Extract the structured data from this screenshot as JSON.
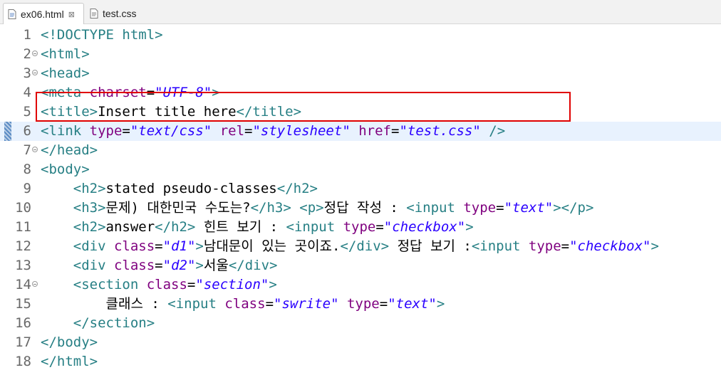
{
  "tabs": [
    {
      "label": "ex06.html",
      "active": true,
      "close": "⊠"
    },
    {
      "label": "test.css",
      "active": false
    }
  ],
  "highlight_color": "#e00000",
  "lines": [
    {
      "num": "1",
      "fold": false,
      "tokens": [
        [
          "tag",
          "<!DOCTYPE html>"
        ]
      ]
    },
    {
      "num": "2",
      "fold": true,
      "tokens": [
        [
          "tag",
          "<html>"
        ]
      ]
    },
    {
      "num": "3",
      "fold": true,
      "tokens": [
        [
          "tag",
          "<head>"
        ]
      ]
    },
    {
      "num": "4",
      "fold": false,
      "tokens": [
        [
          "tag",
          "<meta "
        ],
        [
          "attr",
          "charset"
        ],
        [
          "txt",
          "="
        ],
        [
          "val",
          "\"UTF-8\""
        ],
        [
          "tag",
          ">"
        ]
      ]
    },
    {
      "num": "5",
      "fold": false,
      "tokens": [
        [
          "tag",
          "<title>"
        ],
        [
          "txt",
          "Insert title here"
        ],
        [
          "tag",
          "</title>"
        ]
      ]
    },
    {
      "num": "6",
      "fold": false,
      "current": true,
      "tokens": [
        [
          "tag",
          "<link "
        ],
        [
          "attr",
          "type"
        ],
        [
          "txt",
          "="
        ],
        [
          "val",
          "\"text/css\""
        ],
        [
          "txt",
          " "
        ],
        [
          "attr",
          "rel"
        ],
        [
          "txt",
          "="
        ],
        [
          "val",
          "\"stylesheet\""
        ],
        [
          "txt",
          " "
        ],
        [
          "attr",
          "href"
        ],
        [
          "txt",
          "="
        ],
        [
          "val",
          "\"test.css\""
        ],
        [
          "txt",
          " "
        ],
        [
          "tag",
          "/>"
        ]
      ]
    },
    {
      "num": "7",
      "fold": true,
      "tokens": [
        [
          "tag",
          "</head>"
        ]
      ]
    },
    {
      "num": "8",
      "fold": false,
      "tokens": [
        [
          "tag",
          "<body>"
        ]
      ]
    },
    {
      "num": "9",
      "fold": false,
      "tokens": [
        [
          "txt",
          "    "
        ],
        [
          "tag",
          "<h2>"
        ],
        [
          "txt",
          "stated pseudo-classes"
        ],
        [
          "tag",
          "</h2>"
        ]
      ]
    },
    {
      "num": "10",
      "fold": false,
      "tokens": [
        [
          "txt",
          "    "
        ],
        [
          "tag",
          "<h3>"
        ],
        [
          "txt",
          "문제) 대한민국 수도는?"
        ],
        [
          "tag",
          "</h3>"
        ],
        [
          "txt",
          " "
        ],
        [
          "tag",
          "<p>"
        ],
        [
          "txt",
          "정답 작성 : "
        ],
        [
          "tag",
          "<input "
        ],
        [
          "attr",
          "type"
        ],
        [
          "txt",
          "="
        ],
        [
          "val",
          "\"text\""
        ],
        [
          "tag",
          "></p>"
        ]
      ]
    },
    {
      "num": "11",
      "fold": false,
      "tokens": [
        [
          "txt",
          "    "
        ],
        [
          "tag",
          "<h2>"
        ],
        [
          "txt",
          "answer"
        ],
        [
          "tag",
          "</h2>"
        ],
        [
          "txt",
          " 힌트 보기 : "
        ],
        [
          "tag",
          "<input "
        ],
        [
          "attr",
          "type"
        ],
        [
          "txt",
          "="
        ],
        [
          "val",
          "\"checkbox\""
        ],
        [
          "tag",
          ">"
        ]
      ]
    },
    {
      "num": "12",
      "fold": false,
      "tokens": [
        [
          "txt",
          "    "
        ],
        [
          "tag",
          "<div "
        ],
        [
          "attr",
          "class"
        ],
        [
          "txt",
          "="
        ],
        [
          "val",
          "\"d1\""
        ],
        [
          "tag",
          ">"
        ],
        [
          "txt",
          "남대문이 있는 곳이죠."
        ],
        [
          "tag",
          "</div>"
        ],
        [
          "txt",
          " 정답 보기 :"
        ],
        [
          "tag",
          "<input "
        ],
        [
          "attr",
          "type"
        ],
        [
          "txt",
          "="
        ],
        [
          "val",
          "\"checkbox\""
        ],
        [
          "tag",
          ">"
        ]
      ]
    },
    {
      "num": "13",
      "fold": false,
      "tokens": [
        [
          "txt",
          "    "
        ],
        [
          "tag",
          "<div "
        ],
        [
          "attr",
          "class"
        ],
        [
          "txt",
          "="
        ],
        [
          "val",
          "\"d2\""
        ],
        [
          "tag",
          ">"
        ],
        [
          "txt",
          "서울"
        ],
        [
          "tag",
          "</div>"
        ]
      ]
    },
    {
      "num": "14",
      "fold": true,
      "tokens": [
        [
          "txt",
          "    "
        ],
        [
          "tag",
          "<section "
        ],
        [
          "attr",
          "class"
        ],
        [
          "txt",
          "="
        ],
        [
          "val",
          "\"section\""
        ],
        [
          "tag",
          ">"
        ]
      ]
    },
    {
      "num": "15",
      "fold": false,
      "tokens": [
        [
          "txt",
          "        클래스 : "
        ],
        [
          "tag",
          "<input "
        ],
        [
          "attr",
          "class"
        ],
        [
          "txt",
          "="
        ],
        [
          "val",
          "\"swrite\""
        ],
        [
          "txt",
          " "
        ],
        [
          "attr",
          "type"
        ],
        [
          "txt",
          "="
        ],
        [
          "val",
          "\"text\""
        ],
        [
          "tag",
          ">"
        ]
      ]
    },
    {
      "num": "16",
      "fold": false,
      "tokens": [
        [
          "txt",
          "    "
        ],
        [
          "tag",
          "</section>"
        ]
      ]
    },
    {
      "num": "17",
      "fold": false,
      "tokens": [
        [
          "tag",
          "</body>"
        ]
      ]
    },
    {
      "num": "18",
      "fold": false,
      "tokens": [
        [
          "tag",
          "</html>"
        ]
      ]
    }
  ]
}
